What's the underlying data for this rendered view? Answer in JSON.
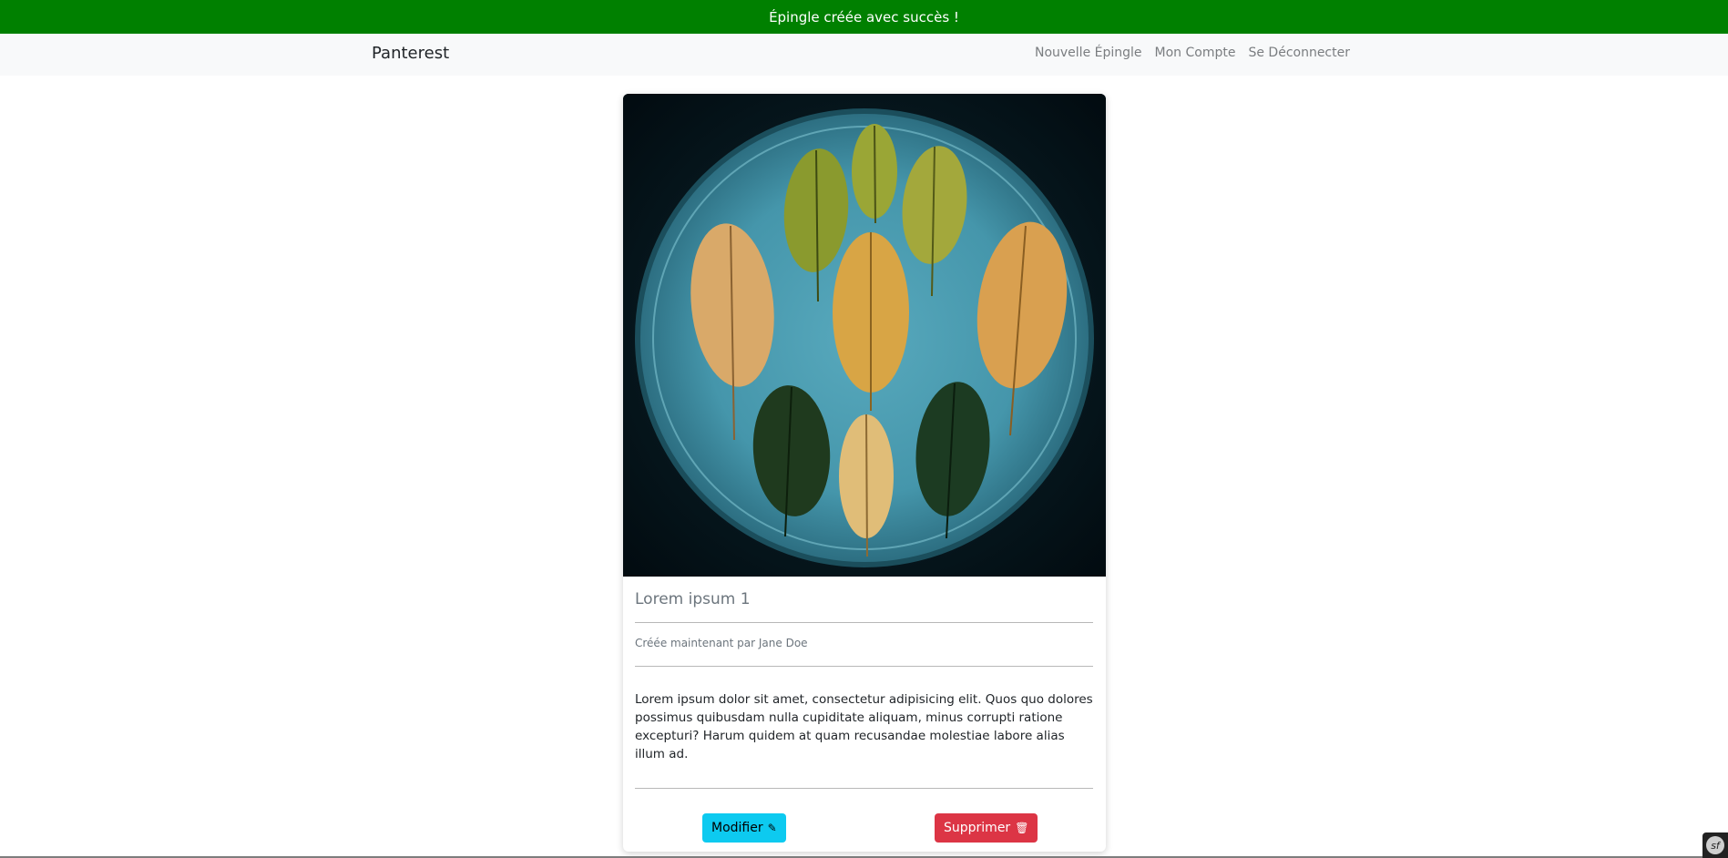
{
  "flash": {
    "message": "Épingle créée avec succès !",
    "background_color": "#008000"
  },
  "navbar": {
    "brand": "Panterest",
    "links": [
      {
        "label": "Nouvelle Épingle"
      },
      {
        "label": "Mon Compte"
      },
      {
        "label": "Se Déconnecter"
      }
    ]
  },
  "pin": {
    "image_alt": "Feuilles d'automne sur une assiette bleue",
    "title": "Lorem ipsum 1",
    "meta": "Créée maintenant par Jane Doe",
    "description": "Lorem ipsum dolor sit amet, consectetur adipisicing elit. Quos quo dolores possimus quibusdam nulla cupiditate aliquam, minus corrupti ratione excepturi? Harum quidem at quam recusandae molestiae labore alias illum ad.",
    "edit_label": "Modifier",
    "edit_icon": "pencil-icon",
    "delete_label": "Supprimer",
    "delete_icon": "trash-icon",
    "edit_color": "#0dcaf0",
    "delete_color": "#dc3545"
  },
  "debug_toolbar": {
    "icon": "symfony-icon"
  }
}
